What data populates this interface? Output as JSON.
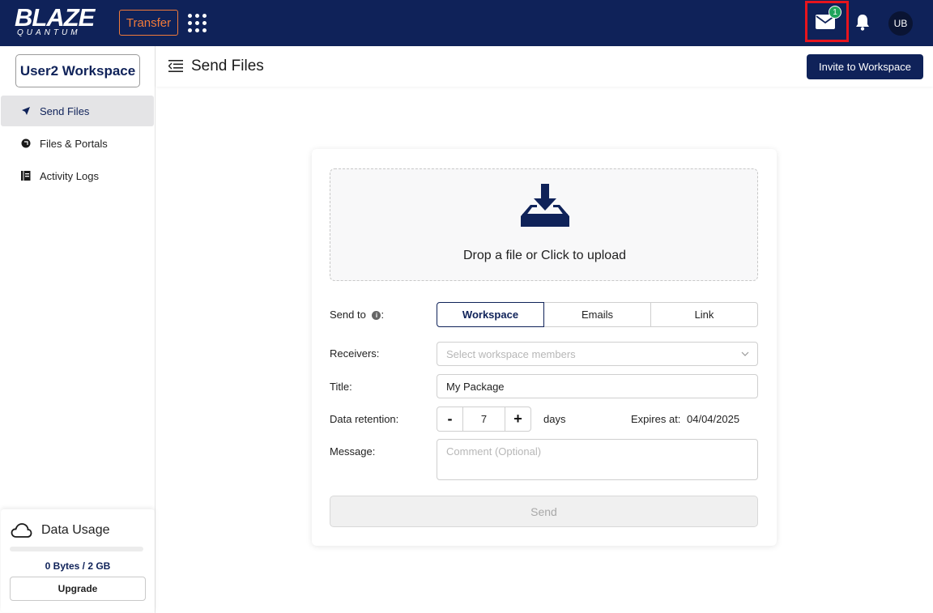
{
  "topbar": {
    "logo_main": "BLAZE",
    "logo_sub": "QUANTUM",
    "transfer_label": "Transfer",
    "mail_badge_count": "1",
    "avatar_initials": "UB",
    "colors": {
      "bg": "#0f2259",
      "transfer_accent": "#f07a3a",
      "badge": "#1fa45c",
      "highlight": "#e8141d"
    },
    "icons": [
      "apps-grid-icon",
      "mail-icon",
      "bell-icon"
    ]
  },
  "sidebar": {
    "workspace_label": "User2 Workspace",
    "items": [
      {
        "label": "Send Files",
        "icon": "send-icon",
        "active": true
      },
      {
        "label": "Files & Portals",
        "icon": "files-icon",
        "active": false
      },
      {
        "label": "Activity Logs",
        "icon": "activity-log-icon",
        "active": false
      }
    ],
    "usage": {
      "title": "Data Usage",
      "text": "0 Bytes / 2 GB",
      "fill_fraction": 0,
      "upgrade_label": "Upgrade"
    }
  },
  "header": {
    "title": "Send Files",
    "invite_label": "Invite to Workspace"
  },
  "form": {
    "dropzone_text": "Drop a file or Click to upload",
    "send_to_label": "Send to",
    "send_to_suffix": ":",
    "send_to_options": [
      "Workspace",
      "Emails",
      "Link"
    ],
    "send_to_selected": "Workspace",
    "receivers_label": "Receivers:",
    "receivers_placeholder": "Select workspace members",
    "title_label": "Title:",
    "title_value": "My Package",
    "retention_label": "Data retention:",
    "retention_minus": "-",
    "retention_value": "7",
    "retention_plus": "+",
    "retention_unit": "days",
    "expires_label": "Expires at:",
    "expires_value": "04/04/2025",
    "message_label": "Message:",
    "message_placeholder": "Comment (Optional)",
    "send_label": "Send"
  }
}
